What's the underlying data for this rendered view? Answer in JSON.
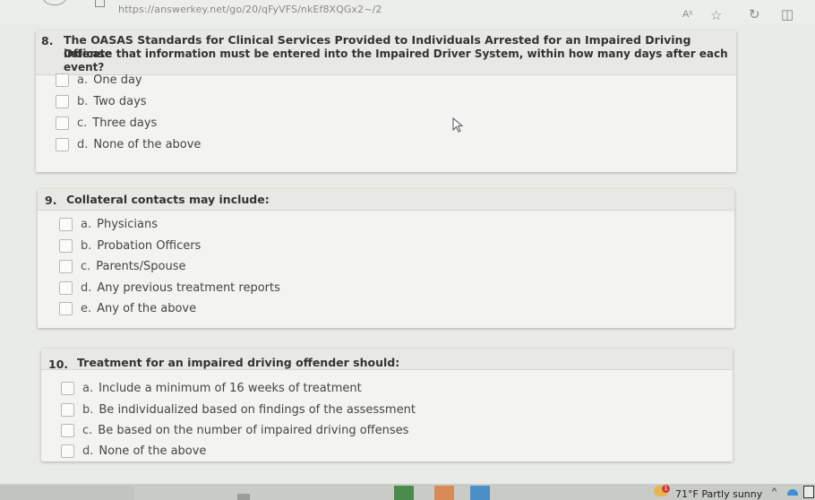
{
  "browser": {
    "url": "https://answerkey.net/go/20/qFyVFS/nkEf8XQGx2~/2",
    "read_aloud_icon": "Aˢ",
    "favorite_icon": "☆",
    "refresh_icon": "↻",
    "split_icon": "◫"
  },
  "questions": [
    {
      "number": "8.",
      "text_line1": "The OASAS Standards for Clinical Services Provided to Individuals Arrested for an Impaired Driving Offense",
      "text_line2": "indicate that information must be entered into the Impaired Driver System, within how many days after each event?",
      "options": [
        {
          "letter": "a.",
          "text": "One day"
        },
        {
          "letter": "b.",
          "text": "Two days"
        },
        {
          "letter": "c.",
          "text": "Three days"
        },
        {
          "letter": "d.",
          "text": "None of the above"
        }
      ]
    },
    {
      "number": "9.",
      "text_line1": "Collateral contacts may include:",
      "options": [
        {
          "letter": "a.",
          "text": "Physicians"
        },
        {
          "letter": "b.",
          "text": "Probation Officers"
        },
        {
          "letter": "c.",
          "text": "Parents/Spouse"
        },
        {
          "letter": "d.",
          "text": "Any previous treatment reports"
        },
        {
          "letter": "e.",
          "text": "Any of the above"
        }
      ]
    },
    {
      "number": "10.",
      "text_line1": "Treatment for an impaired driving offender should:",
      "options": [
        {
          "letter": "a.",
          "text": "Include a minimum of 16 weeks of treatment"
        },
        {
          "letter": "b.",
          "text": "Be individualized based on findings of the assessment"
        },
        {
          "letter": "c.",
          "text": "Be based on the number of impaired driving offenses"
        },
        {
          "letter": "d.",
          "text": "None of the above"
        }
      ]
    }
  ],
  "taskbar": {
    "weather_text": "71°F  Partly sunny",
    "weather_badge": "1",
    "tray_chevron": "^"
  }
}
